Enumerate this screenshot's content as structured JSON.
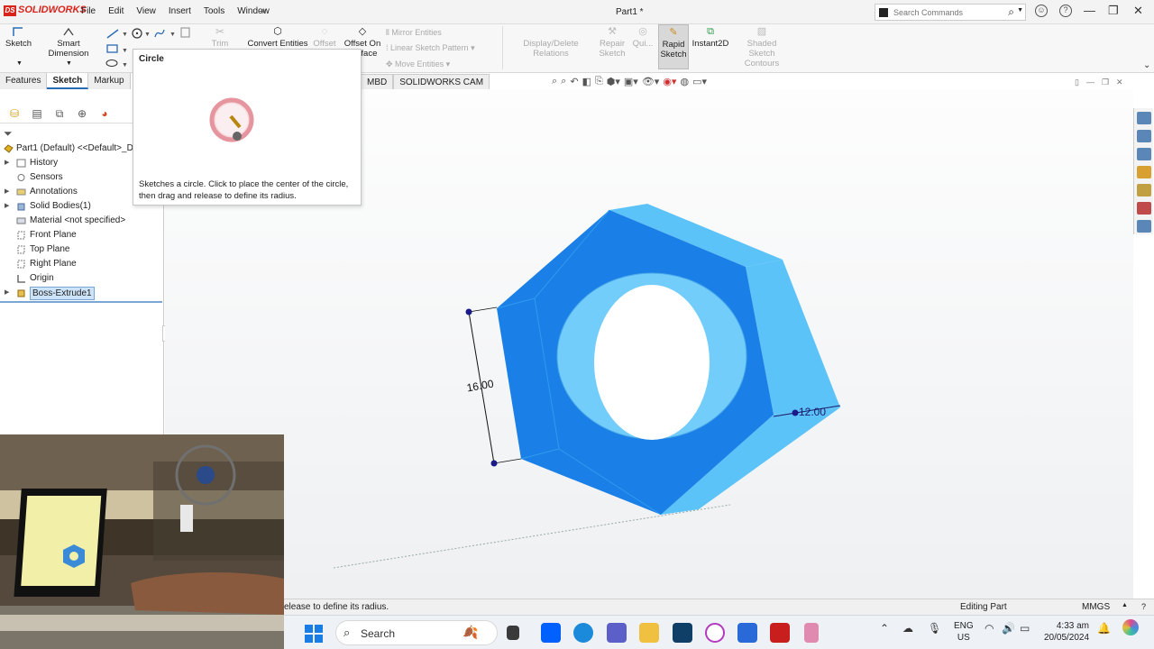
{
  "titlebar": {
    "brand": "SOLIDWORKS",
    "brand_mark": "DS",
    "menu": [
      "File",
      "Edit",
      "View",
      "Insert",
      "Tools",
      "Window"
    ],
    "doc_title": "Part1 *",
    "search_placeholder": "Search Commands"
  },
  "commands": {
    "sketch": "Sketch",
    "smart_dimension_1": "Smart",
    "smart_dimension_2": "Dimension",
    "trim": "Trim Entities",
    "convert": "Convert Entities",
    "offset": "Offset",
    "offset_on_1": "Offset On",
    "offset_on_2": "Surface",
    "mirror": "Mirror Entities",
    "linear_pattern": "Linear Sketch Pattern",
    "move": "Move Entities",
    "display_delete": "Display/Delete Relations",
    "repair_1": "Repair",
    "repair_2": "Sketch",
    "quick": "Qui...",
    "rapid_1": "Rapid",
    "rapid_2": "Sketch",
    "instant2d": "Instant2D",
    "shaded_1": "Shaded Sketch",
    "shaded_2": "Contours"
  },
  "tabs": [
    "Features",
    "Sketch",
    "Markup"
  ],
  "tabs_right": [
    "MBD",
    "SOLIDWORKS CAM"
  ],
  "tooltip": {
    "title": "Circle",
    "description": "Sketches a circle. Click to place the center of the circle, then drag and release to define its radius."
  },
  "tree": {
    "root": "Part1 (Default) <<Default>_D",
    "items": [
      {
        "label": "History",
        "expandable": true
      },
      {
        "label": "Sensors",
        "expandable": false
      },
      {
        "label": "Annotations",
        "expandable": true
      },
      {
        "label": "Solid Bodies(1)",
        "expandable": true
      },
      {
        "label": "Material <not specified>",
        "expandable": false
      },
      {
        "label": "Front Plane",
        "expandable": false
      },
      {
        "label": "Top Plane",
        "expandable": false
      },
      {
        "label": "Right Plane",
        "expandable": false
      },
      {
        "label": "Origin",
        "expandable": false
      },
      {
        "label": "Boss-Extrude1",
        "expandable": true
      }
    ]
  },
  "model": {
    "dimension_height": "16.00",
    "dimension_width": "12.00",
    "colors": {
      "face": "#1a7fe6",
      "side": "#5cc3f9",
      "edge": "#0d5fb8"
    }
  },
  "status": {
    "message": "elease to define its radius.",
    "mode": "Editing Part",
    "units": "MMGS"
  },
  "taskbar": {
    "search": "Search",
    "lang_1": "ENG",
    "lang_2": "US",
    "time": "4:33 am",
    "date": "20/05/2024"
  }
}
